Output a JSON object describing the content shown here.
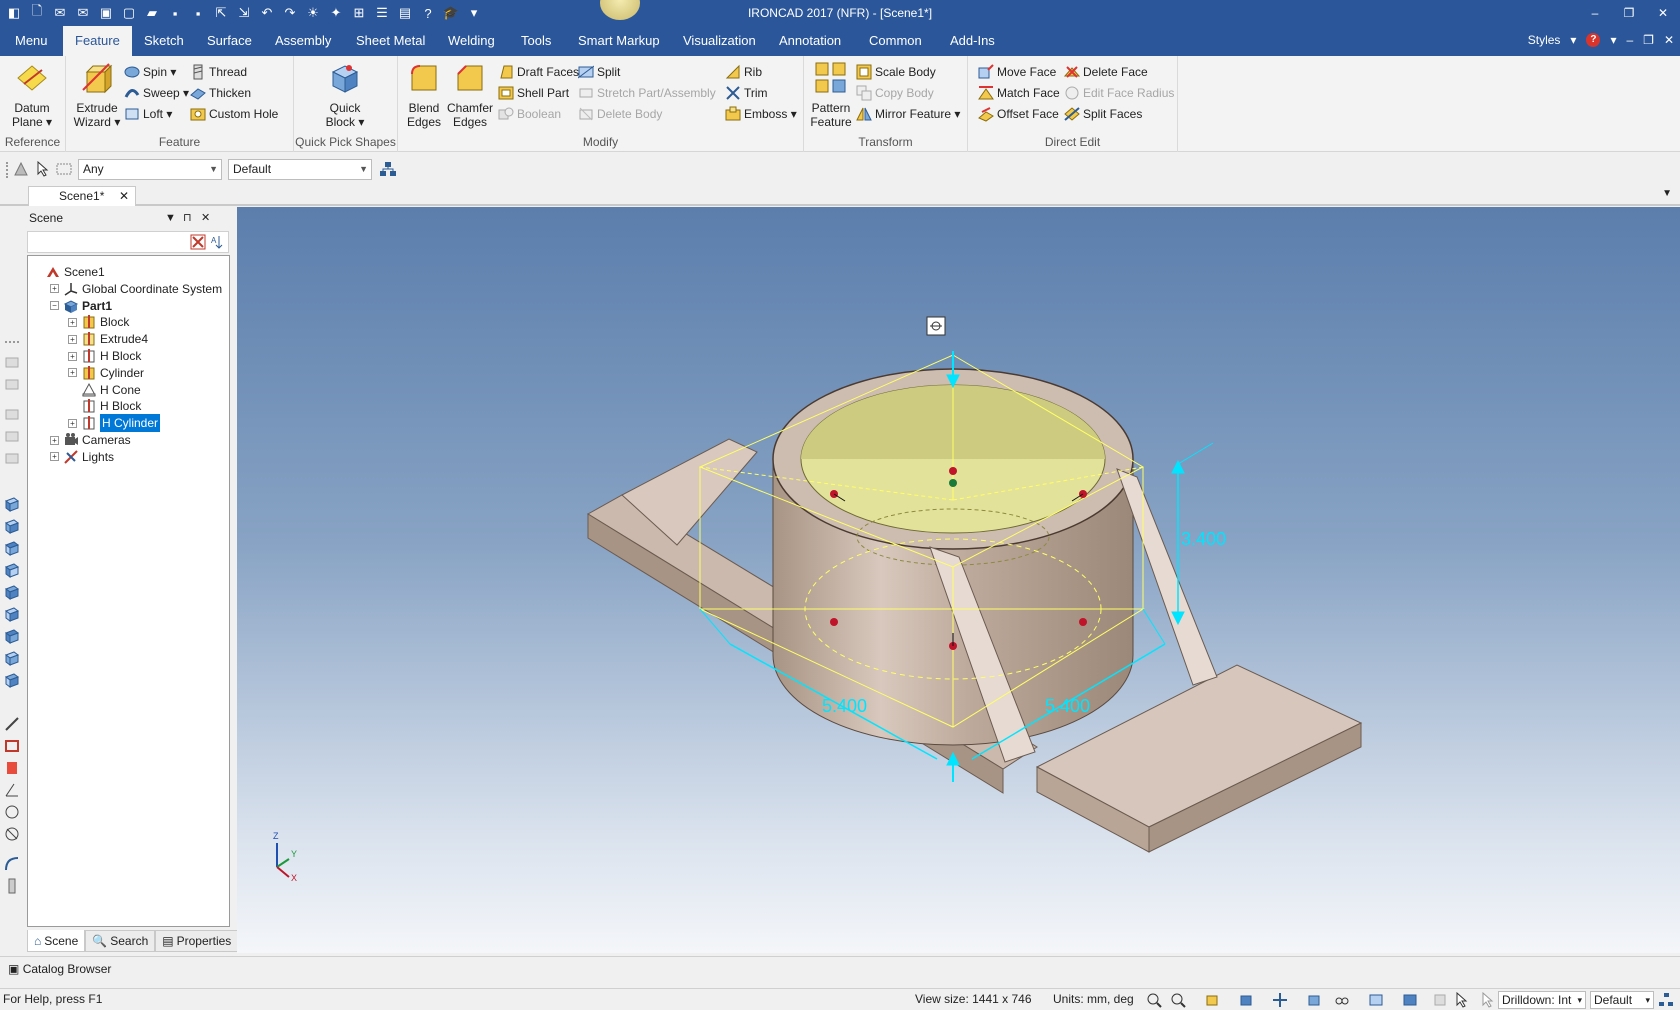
{
  "window": {
    "title": "IRONCAD 2017 (NFR) - [Scene1*]",
    "controls": [
      "–",
      "❐",
      "✕"
    ]
  },
  "tabs": [
    "Menu",
    "Feature",
    "Sketch",
    "Surface",
    "Assembly",
    "Sheet Metal",
    "Welding",
    "Tools",
    "Smart Markup",
    "Visualization",
    "Annotation",
    "Common",
    "Add-Ins"
  ],
  "active_tab": "Feature",
  "tabrow_right": {
    "styles": "Styles"
  },
  "ribbon": {
    "reference": {
      "label": "Reference",
      "datum_plane": "Datum Plane"
    },
    "feature": {
      "label": "Feature",
      "extrude_wizard": "Extrude Wizard",
      "spin": "Spin",
      "sweep": "Sweep",
      "loft": "Loft",
      "thread": "Thread",
      "thicken": "Thicken",
      "custom_hole": "Custom Hole"
    },
    "quick_pick": {
      "label": "Quick Pick Shapes",
      "quick_block": "Quick Block"
    },
    "modify": {
      "label": "Modify",
      "blend_edges": "Blend Edges",
      "chamfer_edges": "Chamfer Edges",
      "draft_faces": "Draft Faces",
      "shell_part": "Shell Part",
      "boolean": "Boolean",
      "split": "Split",
      "stretch": "Stretch Part/Assembly",
      "delete_body": "Delete Body",
      "rib": "Rib",
      "trim": "Trim",
      "emboss": "Emboss"
    },
    "transform": {
      "label": "Transform",
      "pattern_feature": "Pattern Feature",
      "scale_body": "Scale Body",
      "copy_body": "Copy Body",
      "mirror_feature": "Mirror Feature"
    },
    "direct_edit": {
      "label": "Direct Edit",
      "move_face": "Move Face",
      "match_face": "Match Face",
      "offset_face": "Offset Face",
      "delete_face": "Delete Face",
      "edit_face_radius": "Edit Face Radius",
      "split_faces": "Split Faces"
    }
  },
  "filterbar": {
    "selection_filter": "Any",
    "style_combo": "Default"
  },
  "doc_tab": "Scene1*",
  "scene_panel": {
    "title": "Scene",
    "tree": [
      {
        "label": "Scene1",
        "depth": 0,
        "expander": "",
        "icon": "scene",
        "bold": false,
        "selected": false
      },
      {
        "label": "Global Coordinate System",
        "depth": 1,
        "expander": "+",
        "icon": "axes",
        "bold": false,
        "selected": false
      },
      {
        "label": "Part1",
        "depth": 1,
        "expander": "−",
        "icon": "part",
        "bold": true,
        "selected": false
      },
      {
        "label": "Block",
        "depth": 2,
        "expander": "+",
        "icon": "feature",
        "bold": false,
        "selected": false
      },
      {
        "label": "Extrude4",
        "depth": 2,
        "expander": "+",
        "icon": "feature-red",
        "bold": false,
        "selected": false
      },
      {
        "label": "H Block",
        "depth": 2,
        "expander": "+",
        "icon": "hole",
        "bold": false,
        "selected": false
      },
      {
        "label": "Cylinder",
        "depth": 2,
        "expander": "+",
        "icon": "feature",
        "bold": false,
        "selected": false
      },
      {
        "label": "H Cone",
        "depth": 2,
        "expander": "",
        "icon": "cone",
        "bold": false,
        "selected": false
      },
      {
        "label": "H Block",
        "depth": 2,
        "expander": "",
        "icon": "hole",
        "bold": false,
        "selected": false
      },
      {
        "label": "H Cylinder",
        "depth": 2,
        "expander": "+",
        "icon": "hole",
        "bold": false,
        "selected": true
      },
      {
        "label": "Cameras",
        "depth": 1,
        "expander": "+",
        "icon": "camera",
        "bold": false,
        "selected": false
      },
      {
        "label": "Lights",
        "depth": 1,
        "expander": "+",
        "icon": "light",
        "bold": false,
        "selected": false
      }
    ],
    "tabs": [
      "Scene",
      "Search",
      "Properties"
    ]
  },
  "viewport": {
    "dimension_height": "3.400",
    "dimension_width": "5.400",
    "dimension_depth": "5.400",
    "axis_labels": [
      "Z",
      "Y",
      "X"
    ]
  },
  "catalog_browser": "Catalog Browser",
  "status": {
    "help": "For Help, press F1",
    "view_size": "View size: 1441 x  746",
    "units": "Units: mm, deg",
    "drilldown": "Drilldown: Int",
    "style": "Default"
  },
  "colors": {
    "title_bg": "#2b579a",
    "part_face": "#d6c6bb",
    "part_shadow": "#a89484",
    "inner_face": "#e3e29a",
    "triball": "#ffff66",
    "dimension": "#00e5ff",
    "selection": "#0078d7"
  }
}
